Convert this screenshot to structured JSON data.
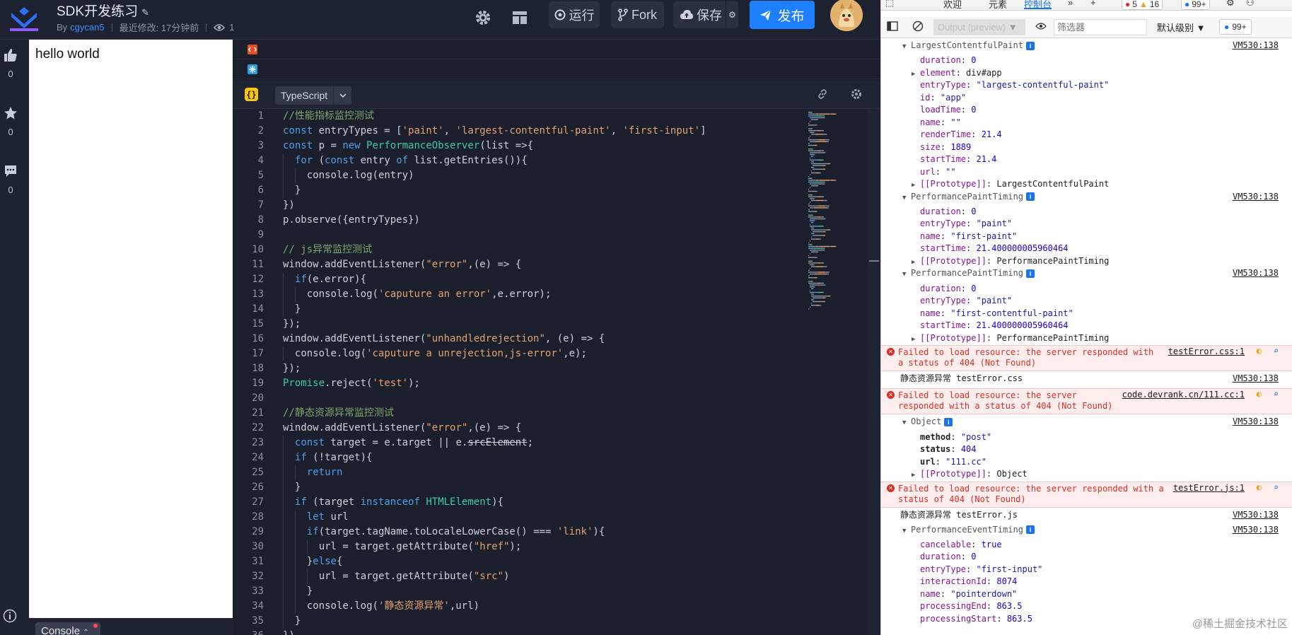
{
  "header": {
    "title": "SDK开发练习",
    "author_prefix": "By",
    "author": "cgycan5",
    "modified": "最近修改: 17分钟前",
    "views": "1",
    "run_label": "运行",
    "fork_label": "Fork",
    "save_label": "保存",
    "publish_label": "发布",
    "accent": "#1e80ff"
  },
  "sidebar": {
    "like_count": "0",
    "star_count": "0",
    "comment_count": "0"
  },
  "preview": {
    "text": "hello world",
    "console_tab": "Console"
  },
  "editor": {
    "language": "TypeScript",
    "ts_badge": "{}",
    "lines": [
      {
        "n": "1",
        "indent": 0,
        "parts": [
          [
            "c",
            "//性能指标监控测试"
          ]
        ]
      },
      {
        "n": "2",
        "indent": 0,
        "parts": [
          [
            "k",
            "const"
          ],
          [
            "p",
            " entryTypes = ["
          ],
          [
            "s",
            "'paint'"
          ],
          [
            "p",
            ", "
          ],
          [
            "s",
            "'largest-contentful-paint'"
          ],
          [
            "p",
            ", "
          ],
          [
            "s",
            "'first-input'"
          ],
          [
            "p",
            "]"
          ]
        ]
      },
      {
        "n": "3",
        "indent": 0,
        "parts": [
          [
            "k",
            "const"
          ],
          [
            "p",
            " p = "
          ],
          [
            "k",
            "new"
          ],
          [
            "p",
            " "
          ],
          [
            "t",
            "PerformanceObserver"
          ],
          [
            "p",
            "(list =>{"
          ]
        ]
      },
      {
        "n": "4",
        "indent": 1,
        "parts": [
          [
            "k",
            "for"
          ],
          [
            "p",
            " ("
          ],
          [
            "k",
            "const"
          ],
          [
            "p",
            " entry "
          ],
          [
            "k",
            "of"
          ],
          [
            "p",
            " list.getEntries()){"
          ]
        ]
      },
      {
        "n": "5",
        "indent": 2,
        "parts": [
          [
            "p",
            "console.log(entry)"
          ]
        ]
      },
      {
        "n": "6",
        "indent": 1,
        "parts": [
          [
            "p",
            "}"
          ]
        ]
      },
      {
        "n": "7",
        "indent": 0,
        "parts": [
          [
            "p",
            "})"
          ]
        ]
      },
      {
        "n": "8",
        "indent": 0,
        "parts": [
          [
            "p",
            "p.observe({entryTypes})"
          ]
        ]
      },
      {
        "n": "9",
        "indent": 0,
        "parts": []
      },
      {
        "n": "10",
        "indent": 0,
        "parts": [
          [
            "c",
            "// js异常监控测试"
          ]
        ]
      },
      {
        "n": "11",
        "indent": 0,
        "parts": [
          [
            "p",
            "window.addEventListener("
          ],
          [
            "s",
            "\"error\""
          ],
          [
            "p",
            ",(e) => {"
          ]
        ]
      },
      {
        "n": "12",
        "indent": 1,
        "parts": [
          [
            "k",
            "if"
          ],
          [
            "p",
            "(e.error){"
          ]
        ]
      },
      {
        "n": "13",
        "indent": 2,
        "parts": [
          [
            "p",
            "console.log("
          ],
          [
            "s",
            "'caputure an error'"
          ],
          [
            "p",
            ",e.error);"
          ]
        ]
      },
      {
        "n": "14",
        "indent": 1,
        "parts": [
          [
            "p",
            "}"
          ]
        ]
      },
      {
        "n": "15",
        "indent": 0,
        "parts": [
          [
            "p",
            "});"
          ]
        ]
      },
      {
        "n": "16",
        "indent": 0,
        "parts": [
          [
            "p",
            "window.addEventListener("
          ],
          [
            "s",
            "\"unhandledrejection\""
          ],
          [
            "p",
            ", (e) => {"
          ]
        ]
      },
      {
        "n": "17",
        "indent": 1,
        "parts": [
          [
            "p",
            "console.log("
          ],
          [
            "s",
            "'caputure a unrejection,js-error'"
          ],
          [
            "p",
            ",e);"
          ]
        ]
      },
      {
        "n": "18",
        "indent": 0,
        "parts": [
          [
            "p",
            "});"
          ]
        ]
      },
      {
        "n": "19",
        "indent": 0,
        "parts": [
          [
            "t",
            "Promise"
          ],
          [
            "p",
            ".reject("
          ],
          [
            "s",
            "'test'"
          ],
          [
            "p",
            ");"
          ]
        ]
      },
      {
        "n": "20",
        "indent": 0,
        "parts": []
      },
      {
        "n": "21",
        "indent": 0,
        "parts": [
          [
            "c",
            "//静态资源异常监控测试"
          ]
        ]
      },
      {
        "n": "22",
        "indent": 0,
        "parts": [
          [
            "p",
            "window.addEventListener("
          ],
          [
            "s",
            "\"error\""
          ],
          [
            "p",
            ",(e) => {"
          ]
        ]
      },
      {
        "n": "23",
        "indent": 1,
        "parts": [
          [
            "k",
            "const"
          ],
          [
            "p",
            " target = e.target || e."
          ],
          [
            "st",
            "srcElement"
          ],
          [
            "p",
            ";"
          ]
        ]
      },
      {
        "n": "24",
        "indent": 1,
        "parts": [
          [
            "k",
            "if"
          ],
          [
            "p",
            " (!target){"
          ]
        ]
      },
      {
        "n": "25",
        "indent": 2,
        "parts": [
          [
            "k",
            "return"
          ]
        ]
      },
      {
        "n": "26",
        "indent": 1,
        "parts": [
          [
            "p",
            "}"
          ]
        ]
      },
      {
        "n": "27",
        "indent": 1,
        "parts": [
          [
            "k",
            "if"
          ],
          [
            "p",
            " (target "
          ],
          [
            "k",
            "instanceof"
          ],
          [
            "p",
            " "
          ],
          [
            "t",
            "HTMLElement"
          ],
          [
            "p",
            "){"
          ]
        ]
      },
      {
        "n": "28",
        "indent": 2,
        "parts": [
          [
            "k",
            "let"
          ],
          [
            "p",
            " url"
          ]
        ]
      },
      {
        "n": "29",
        "indent": 2,
        "parts": [
          [
            "k",
            "if"
          ],
          [
            "p",
            "(target.tagName.toLocaleLowerCase() === "
          ],
          [
            "s",
            "'link'"
          ],
          [
            "p",
            "){"
          ]
        ]
      },
      {
        "n": "30",
        "indent": 3,
        "parts": [
          [
            "p",
            "url = target.getAttribute("
          ],
          [
            "s",
            "\"href\""
          ],
          [
            "p",
            ");"
          ]
        ]
      },
      {
        "n": "31",
        "indent": 2,
        "parts": [
          [
            "p",
            "}"
          ],
          [
            "k",
            "else"
          ],
          [
            "p",
            "{"
          ]
        ]
      },
      {
        "n": "32",
        "indent": 3,
        "parts": [
          [
            "p",
            "url = target.getAttribute("
          ],
          [
            "s",
            "\"src\""
          ],
          [
            "p",
            ")"
          ]
        ]
      },
      {
        "n": "33",
        "indent": 2,
        "parts": [
          [
            "p",
            "}"
          ]
        ]
      },
      {
        "n": "34",
        "indent": 2,
        "parts": [
          [
            "p",
            "console.log("
          ],
          [
            "s",
            "'静态资源异常'"
          ],
          [
            "p",
            ",url)"
          ]
        ]
      },
      {
        "n": "35",
        "indent": 1,
        "parts": [
          [
            "p",
            "}"
          ]
        ]
      },
      {
        "n": "36",
        "indent": 0,
        "parts": [
          [
            "p",
            "})"
          ]
        ]
      }
    ]
  },
  "devtools": {
    "tabs": [
      "欢迎",
      "元素",
      "控制台"
    ],
    "error_count": "5",
    "warn_count": "16",
    "msg_count": "99+",
    "context": "Output (preview)",
    "filter_placeholder": "筛选器",
    "level": "默认级别",
    "issues": "99+",
    "rows": [
      {
        "type": "group",
        "text": "LargestContentfulPaint",
        "src": "VM530:138"
      },
      {
        "type": "prop",
        "indent": 1,
        "key": "duration",
        "val": "0",
        "vt": "num"
      },
      {
        "type": "prop",
        "indent": 1,
        "tri": true,
        "key": "element",
        "val": "div#app",
        "vt": "plain"
      },
      {
        "type": "prop",
        "indent": 1,
        "key": "entryType",
        "val": "\"largest-contentful-paint\"",
        "vt": "str"
      },
      {
        "type": "prop",
        "indent": 1,
        "key": "id",
        "val": "\"app\"",
        "vt": "str"
      },
      {
        "type": "prop",
        "indent": 1,
        "key": "loadTime",
        "val": "0",
        "vt": "num"
      },
      {
        "type": "prop",
        "indent": 1,
        "key": "name",
        "val": "\"\"",
        "vt": "str"
      },
      {
        "type": "prop",
        "indent": 1,
        "key": "renderTime",
        "val": "21.4",
        "vt": "num"
      },
      {
        "type": "prop",
        "indent": 1,
        "key": "size",
        "val": "1889",
        "vt": "num"
      },
      {
        "type": "prop",
        "indent": 1,
        "key": "startTime",
        "val": "21.4",
        "vt": "num"
      },
      {
        "type": "prop",
        "indent": 1,
        "key": "url",
        "val": "\"\"",
        "vt": "str"
      },
      {
        "type": "prop",
        "indent": 1,
        "tri": true,
        "key": "[[Prototype]]",
        "val": "LargestContentfulPaint",
        "vt": "plain"
      },
      {
        "type": "group",
        "text": "PerformancePaintTiming",
        "src": "VM530:138"
      },
      {
        "type": "prop",
        "indent": 1,
        "key": "duration",
        "val": "0",
        "vt": "num"
      },
      {
        "type": "prop",
        "indent": 1,
        "key": "entryType",
        "val": "\"paint\"",
        "vt": "str"
      },
      {
        "type": "prop",
        "indent": 1,
        "key": "name",
        "val": "\"first-paint\"",
        "vt": "str"
      },
      {
        "type": "prop",
        "indent": 1,
        "key": "startTime",
        "val": "21.400000005960464",
        "vt": "num"
      },
      {
        "type": "prop",
        "indent": 1,
        "tri": true,
        "key": "[[Prototype]]",
        "val": "PerformancePaintTiming",
        "vt": "plain"
      },
      {
        "type": "group",
        "text": "PerformancePaintTiming",
        "src": "VM530:138"
      },
      {
        "type": "prop",
        "indent": 1,
        "key": "duration",
        "val": "0",
        "vt": "num"
      },
      {
        "type": "prop",
        "indent": 1,
        "key": "entryType",
        "val": "\"paint\"",
        "vt": "str"
      },
      {
        "type": "prop",
        "indent": 1,
        "key": "name",
        "val": "\"first-contentful-paint\"",
        "vt": "str"
      },
      {
        "type": "prop",
        "indent": 1,
        "key": "startTime",
        "val": "21.400000005960464",
        "vt": "num"
      },
      {
        "type": "prop",
        "indent": 1,
        "tri": true,
        "key": "[[Prototype]]",
        "val": "PerformancePaintTiming",
        "vt": "plain"
      },
      {
        "type": "error",
        "l1": "Failed to load resource: the server responded with",
        "l2": "a status of 404 (Not Found)",
        "src": "testError.css:1"
      },
      {
        "type": "log",
        "text": "静态资源异常 testError.css",
        "src": "VM530:138"
      },
      {
        "type": "error",
        "l1": "Failed to load resource: the server",
        "l2": "responded with a status of 404 (Not Found)",
        "src": "code.devrank.cn/111.cc:1"
      },
      {
        "type": "group",
        "text": "Object",
        "src": "VM530:138"
      },
      {
        "type": "prop",
        "indent": 1,
        "bold": true,
        "key": "method",
        "val": "\"post\"",
        "vt": "str"
      },
      {
        "type": "prop",
        "indent": 1,
        "bold": true,
        "key": "status",
        "val": "404",
        "vt": "num"
      },
      {
        "type": "prop",
        "indent": 1,
        "bold": true,
        "key": "url",
        "val": "\"111.cc\"",
        "vt": "str"
      },
      {
        "type": "prop",
        "indent": 1,
        "tri": true,
        "key": "[[Prototype]]",
        "val": "Object",
        "vt": "plain"
      },
      {
        "type": "error",
        "l1": "Failed to load resource: the server responded with a",
        "l2": "status of 404 (Not Found)",
        "src": "testError.js:1"
      },
      {
        "type": "log",
        "text": "静态资源异常 testError.js",
        "src": "VM530:138"
      },
      {
        "type": "group",
        "text": "PerformanceEventTiming",
        "src": "VM530:138"
      },
      {
        "type": "prop",
        "indent": 1,
        "key": "cancelable",
        "val": "true",
        "vt": "num"
      },
      {
        "type": "prop",
        "indent": 1,
        "key": "duration",
        "val": "0",
        "vt": "num"
      },
      {
        "type": "prop",
        "indent": 1,
        "key": "entryType",
        "val": "\"first-input\"",
        "vt": "str"
      },
      {
        "type": "prop",
        "indent": 1,
        "key": "interactionId",
        "val": "8074",
        "vt": "num"
      },
      {
        "type": "prop",
        "indent": 1,
        "key": "name",
        "val": "\"pointerdown\"",
        "vt": "str"
      },
      {
        "type": "prop",
        "indent": 1,
        "key": "processingEnd",
        "val": "863.5",
        "vt": "num"
      },
      {
        "type": "prop",
        "indent": 1,
        "key": "processingStart",
        "val": "863.5",
        "vt": "num"
      }
    ],
    "watermark": "@稀土掘金技术社区"
  }
}
